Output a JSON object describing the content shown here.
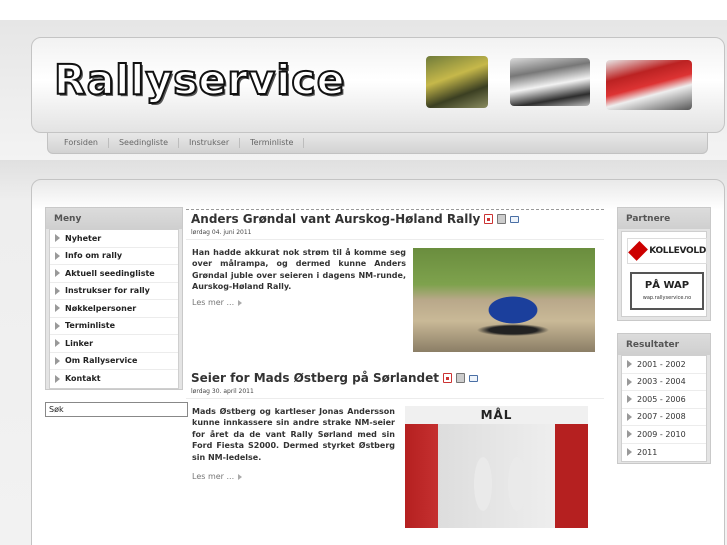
{
  "header": {
    "logo_text": "Rallyservice"
  },
  "topnav": {
    "items": [
      "Forsiden",
      "Seedingliste",
      "Instrukser",
      "Terminliste"
    ]
  },
  "menu": {
    "title": "Meny",
    "items": [
      "Nyheter",
      "Info om rally",
      "Aktuell seedingliste",
      "Instrukser for rally",
      "Nøkkelpersoner",
      "Terminliste",
      "Linker",
      "Om Rallyservice",
      "Kontakt"
    ]
  },
  "search": {
    "value": "Søk"
  },
  "articles": [
    {
      "title": "Anders Grøndal vant Aurskog-Høland Rally",
      "date": "lørdag 04. juni 2011",
      "text": "Han hadde akkurat nok strøm til å komme seg over målrampa, og dermed kunne Anders Grøndal juble over seieren i dagens NM-runde, Aurskog-Høland Rally.",
      "read_more": "Les mer ..."
    },
    {
      "title": "Seier for Mads Østberg på Sørlandet",
      "date": "lørdag 30. april 2011",
      "text": "Mads Østberg og kartleser Jonas Andersson kunne innkassere sin andre strake NM-seier for året da de vant Rally Sørland med sin Ford Fiesta S2000. Dermed styrket Østberg sin NM-ledelse.",
      "read_more": "Les mer ...",
      "photo_banner": "MÅL"
    }
  ],
  "partners": {
    "title": "Partnere",
    "kollevold": "KOLLEVOLD",
    "wap_title": "PÅ WAP",
    "wap_url": "wap.rallyservice.no"
  },
  "results": {
    "title": "Resultater",
    "items": [
      "2001 - 2002",
      "2003 - 2004",
      "2005 - 2006",
      "2007 - 2008",
      "2009 - 2010",
      "2011"
    ]
  },
  "icons": {
    "article_actions": [
      "pdf-icon",
      "print-icon",
      "email-icon"
    ],
    "bullet": "triangle-right-icon"
  }
}
